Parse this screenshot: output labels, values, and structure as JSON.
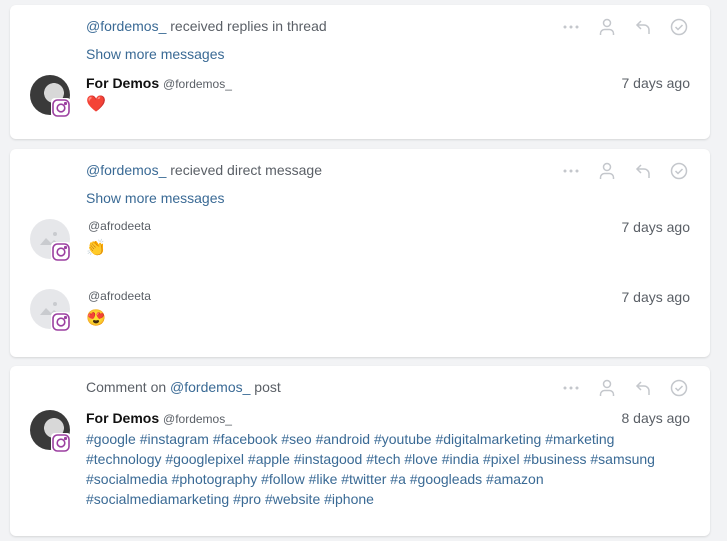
{
  "cards": [
    {
      "title_mention": "@fordemos_",
      "title_rest": " received replies in thread",
      "show_more": "Show more messages",
      "messages": [
        {
          "name": "For Demos",
          "handle": "@fordemos_",
          "time": "7 days ago",
          "content": "❤️"
        }
      ]
    },
    {
      "title_mention": "@fordemos_",
      "title_rest": " recieved direct message",
      "show_more": "Show more messages",
      "messages": [
        {
          "handle": "@afrodeeta",
          "time": "7 days ago",
          "content": "👏"
        },
        {
          "handle": "@afrodeeta",
          "time": "7 days ago",
          "content": "😍"
        }
      ]
    },
    {
      "title_prefix": "Comment on ",
      "title_mention": "@fordemos_",
      "title_rest": " post",
      "messages": [
        {
          "name": "For Demos",
          "handle": "@fordemos_",
          "time": "8 days ago",
          "content": "#google #instagram #facebook #seo #android #youtube #digitalmarketing #marketing #technology #googlepixel #apple #instagood #tech #love #india #pixel #business #samsung #socialmedia #photography #follow #like #twitter #a #googleads #amazon #socialmediamarketing #pro #website #iphone"
        }
      ]
    }
  ],
  "actions": {
    "icons": [
      "more-icon",
      "assign-user-icon",
      "reply-icon",
      "resolve-check-icon"
    ],
    "color": "#c4c7cc"
  },
  "platform_badge": "instagram-icon"
}
